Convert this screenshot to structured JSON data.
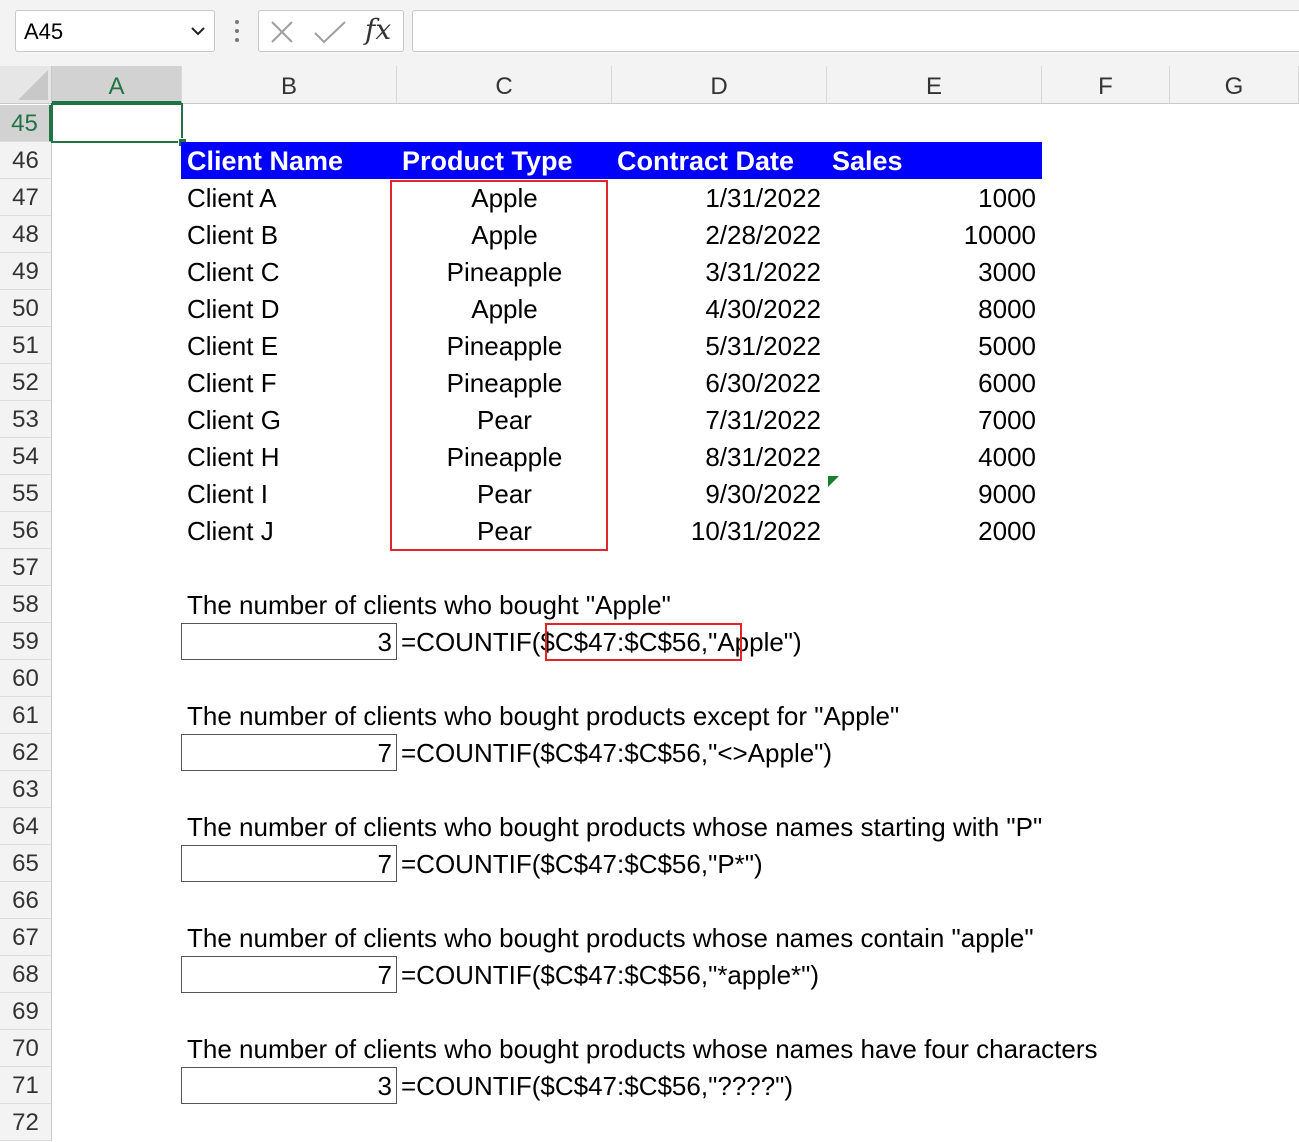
{
  "namebox": {
    "value": "A45"
  },
  "formula_bar": {
    "fx_label": "fx",
    "content": ""
  },
  "columns": [
    "A",
    "B",
    "C",
    "D",
    "E",
    "F",
    "G"
  ],
  "selected_column": "A",
  "rows": [
    "45",
    "46",
    "47",
    "48",
    "49",
    "50",
    "51",
    "52",
    "53",
    "54",
    "55",
    "56",
    "57",
    "58",
    "59",
    "60",
    "61",
    "62",
    "63",
    "64",
    "65",
    "66",
    "67",
    "68",
    "69",
    "70",
    "71",
    "72"
  ],
  "selected_row": "45",
  "table": {
    "headers": [
      "Client Name",
      "Product Type",
      "Contract Date",
      "Sales"
    ],
    "rows": [
      [
        "Client A",
        "Apple",
        "1/31/2022",
        "1000"
      ],
      [
        "Client B",
        "Apple",
        "2/28/2022",
        "10000"
      ],
      [
        "Client C",
        "Pineapple",
        "3/31/2022",
        "3000"
      ],
      [
        "Client D",
        "Apple",
        "4/30/2022",
        "8000"
      ],
      [
        "Client E",
        "Pineapple",
        "5/31/2022",
        "5000"
      ],
      [
        "Client F",
        "Pineapple",
        "6/30/2022",
        "6000"
      ],
      [
        "Client G",
        "Pear",
        "7/31/2022",
        "7000"
      ],
      [
        "Client H",
        "Pineapple",
        "8/31/2022",
        "4000"
      ],
      [
        "Client I",
        "Pear",
        "9/30/2022",
        "9000"
      ],
      [
        "Client J",
        "Pear",
        "10/31/2022",
        "2000"
      ]
    ]
  },
  "examples": [
    {
      "label": "The number of clients who bought \"Apple\"",
      "result": "3",
      "formula_prefix": "=COUNTIF",
      "formula_range": "($C$47:$C$56",
      "formula_rest": ",\"Apple\")"
    },
    {
      "label": "The number of clients who bought products except for \"Apple\"",
      "result": "7",
      "formula_prefix": "=COUNTIF",
      "formula_range": "($C$47:$C$56",
      "formula_rest": ",\"<>Apple\")"
    },
    {
      "label": "The number of clients who bought products whose names starting with \"P\"",
      "result": "7",
      "formula_prefix": "=COUNTIF",
      "formula_range": "($C$47:$C$56",
      "formula_rest": ",\"P*\")"
    },
    {
      "label": "The number of clients who bought products whose names contain \"apple\"",
      "result": "7",
      "formula_prefix": "=COUNTIF",
      "formula_range": "($C$47:$C$56",
      "formula_rest": ",\"*apple*\")"
    },
    {
      "label": "The number of clients who bought products whose names have four characters",
      "result": "3",
      "formula_prefix": "=COUNTIF",
      "formula_range": "($C$47:$C$56",
      "formula_rest": ",\"????\")"
    }
  ],
  "colors": {
    "header_fill": "#0000ff",
    "highlight": "#e0262a",
    "selection": "#217346"
  }
}
